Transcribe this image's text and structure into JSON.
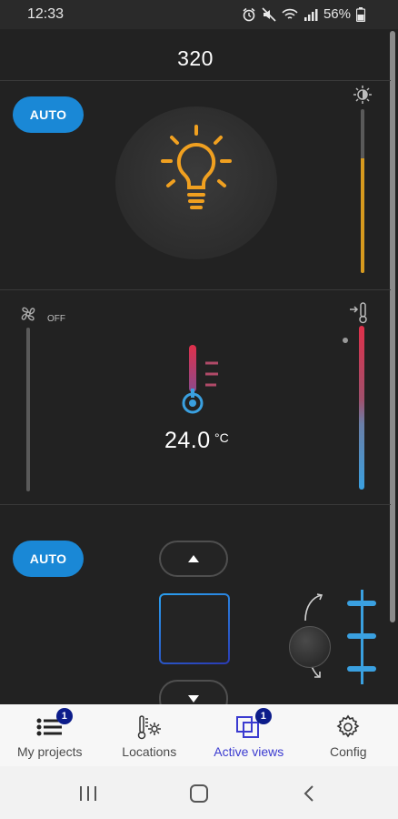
{
  "status_bar": {
    "time": "12:33",
    "battery": "56%",
    "icons": [
      "alarm-icon",
      "mute-icon",
      "wifi-icon",
      "signal-icon",
      "battery-icon"
    ]
  },
  "header": {
    "title": "320"
  },
  "light_section": {
    "auto_label": "AUTO",
    "icon": "light-bulb-icon",
    "brightness_icon": "brightness-icon",
    "dimmer_level": 0.7,
    "accent_color": "#e0a020"
  },
  "climate_section": {
    "fan_icon": "fan-icon",
    "fan_status": "OFF",
    "temperature": "24.0",
    "unit": "°C",
    "thermometer_icon": "thermometer-icon",
    "setpoint_icon": "thermometer-set-icon",
    "colors": {
      "hot": "#e0304a",
      "cold": "#3aa0e0"
    }
  },
  "blind_section": {
    "auto_label": "AUTO",
    "up_icon": "arrow-up-icon",
    "down_icon": "arrow-down-icon",
    "rotate_icon": "rotate-icon",
    "slat_icon": "slats-icon"
  },
  "bottom_nav": {
    "items": [
      {
        "label": "My projects",
        "icon": "list-icon",
        "badge": "1"
      },
      {
        "label": "Locations",
        "icon": "locations-icon",
        "badge": ""
      },
      {
        "label": "Active views",
        "icon": "active-views-icon",
        "badge": "1"
      },
      {
        "label": "Config",
        "icon": "gear-icon",
        "badge": ""
      }
    ],
    "active_index": 2,
    "active_color": "#3b3bd0"
  },
  "system_nav": {
    "icons": [
      "recent-apps-icon",
      "home-icon",
      "back-icon"
    ]
  }
}
